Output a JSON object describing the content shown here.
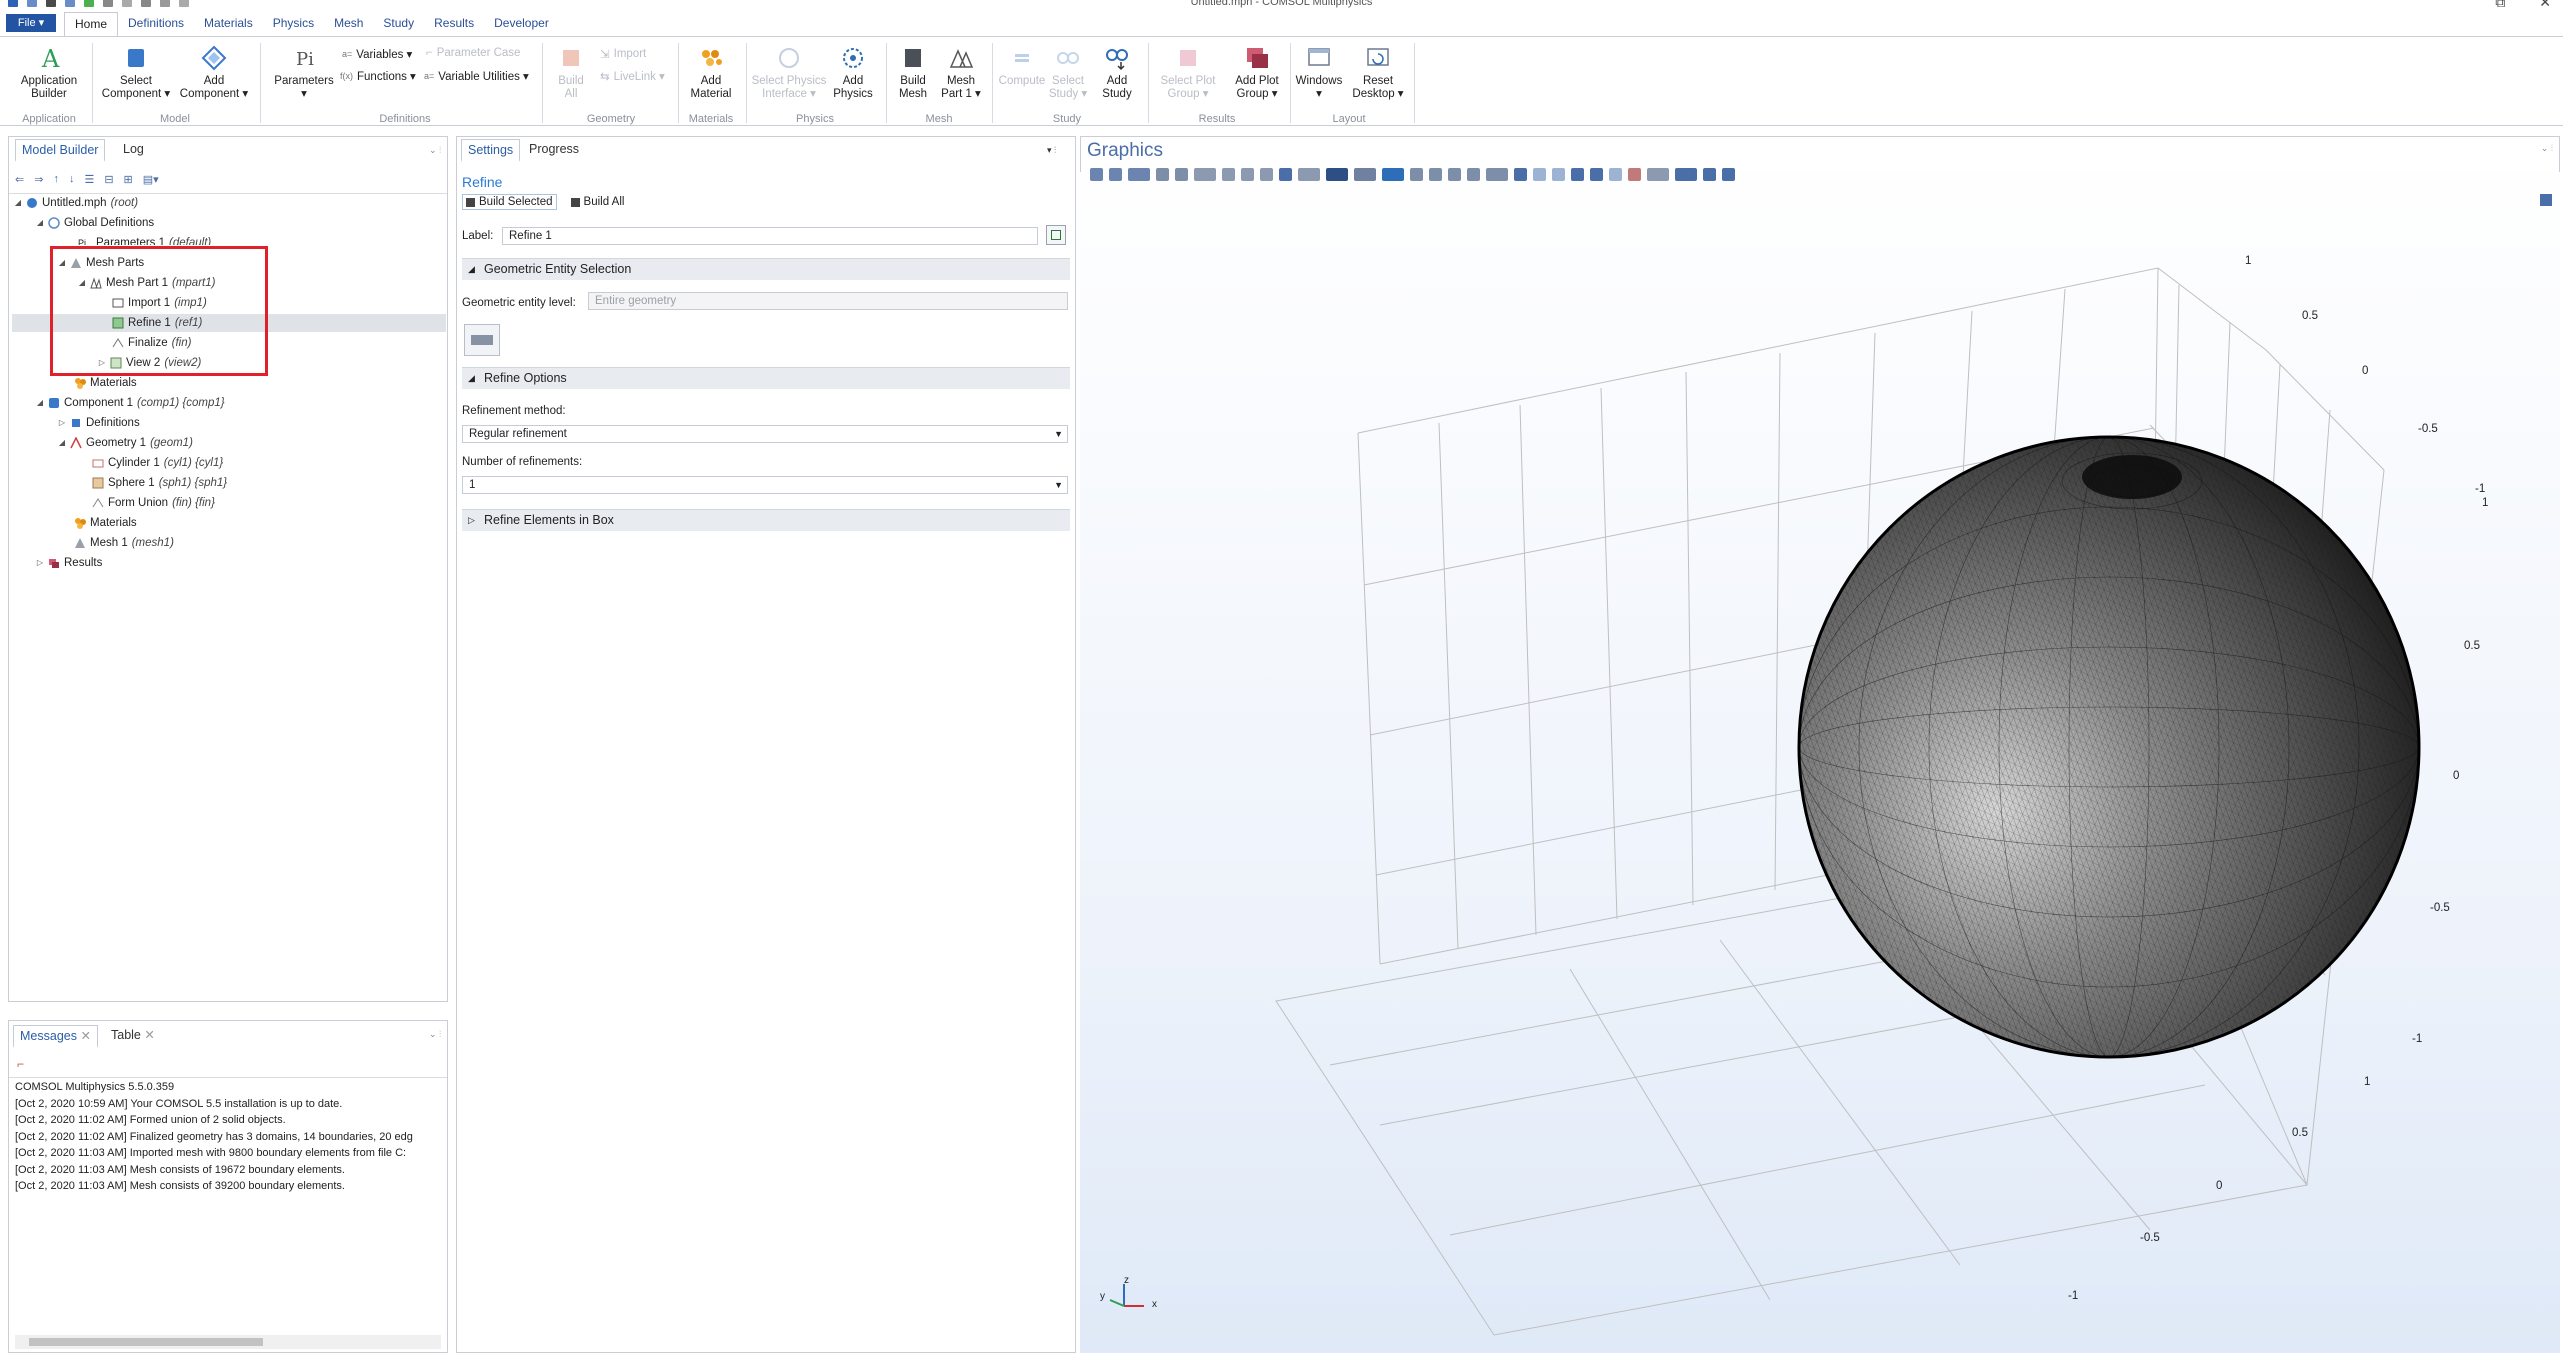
{
  "window": {
    "title": "Untitled.mph - COMSOL Multiphysics"
  },
  "menu": {
    "file": "File ▾",
    "tabs": [
      "Home",
      "Definitions",
      "Materials",
      "Physics",
      "Mesh",
      "Study",
      "Results",
      "Developer"
    ],
    "active": "Home"
  },
  "ribbon": {
    "app_builder": {
      "line1": "Application",
      "line2": "Builder"
    },
    "select_component": {
      "line1": "Select",
      "line2": "Component ▾"
    },
    "add_component": {
      "line1": "Add",
      "line2": "Component ▾"
    },
    "parameters": {
      "line1": "Parameters",
      "line2": "▾"
    },
    "variables": "Variables ▾",
    "functions": "Functions ▾",
    "parameter_case": "Parameter Case",
    "variable_utilities": "Variable Utilities ▾",
    "build_all": {
      "line1": "Build",
      "line2": "All"
    },
    "import": "Import",
    "livelink": "LiveLink ▾",
    "add_material": {
      "line1": "Add",
      "line2": "Material"
    },
    "select_physics": {
      "line1": "Select Physics",
      "line2": "Interface ▾"
    },
    "add_physics": {
      "line1": "Add",
      "line2": "Physics"
    },
    "build_mesh": {
      "line1": "Build",
      "line2": "Mesh"
    },
    "mesh_part": {
      "line1": "Mesh",
      "line2": "Part 1 ▾"
    },
    "compute": {
      "line1": "Compute",
      "line2": ""
    },
    "select_study": {
      "line1": "Select",
      "line2": "Study ▾"
    },
    "add_study": {
      "line1": "Add",
      "line2": "Study"
    },
    "select_plot_group": {
      "line1": "Select Plot",
      "line2": "Group ▾"
    },
    "add_plot_group": {
      "line1": "Add Plot",
      "line2": "Group ▾"
    },
    "windows": {
      "line1": "Windows",
      "line2": "▾"
    },
    "reset_desktop": {
      "line1": "Reset",
      "line2": "Desktop ▾"
    },
    "groups": [
      "Application",
      "Model",
      "Definitions",
      "Geometry",
      "Materials",
      "Physics",
      "Mesh",
      "Study",
      "Results",
      "Layout"
    ]
  },
  "model_builder": {
    "tabs": [
      "Model Builder",
      "Log"
    ],
    "tree": [
      {
        "label": "Untitled.mph",
        "tag": "(root)"
      },
      {
        "label": "Global Definitions",
        "tag": ""
      },
      {
        "label": "Parameters 1",
        "tag": "(default)"
      },
      {
        "label": "Mesh Parts",
        "tag": ""
      },
      {
        "label": "Mesh Part 1",
        "tag": "(mpart1)"
      },
      {
        "label": "Import 1",
        "tag": "(imp1)"
      },
      {
        "label": "Refine 1",
        "tag": "(ref1)"
      },
      {
        "label": "Finalize",
        "tag": "(fin)"
      },
      {
        "label": "View 2",
        "tag": "(view2)"
      },
      {
        "label": "Materials",
        "tag": ""
      },
      {
        "label": "Component 1",
        "tag": "(comp1) {comp1}"
      },
      {
        "label": "Definitions",
        "tag": ""
      },
      {
        "label": "Geometry 1",
        "tag": "(geom1)"
      },
      {
        "label": "Cylinder 1",
        "tag": "(cyl1) {cyl1}"
      },
      {
        "label": "Sphere 1",
        "tag": "(sph1) {sph1}"
      },
      {
        "label": "Form Union",
        "tag": "(fin) {fin}"
      },
      {
        "label": "Materials",
        "tag": ""
      },
      {
        "label": "Mesh 1",
        "tag": "(mesh1)"
      },
      {
        "label": "Results",
        "tag": ""
      }
    ]
  },
  "messages": {
    "tabs": [
      "Messages",
      "Table"
    ],
    "lines": [
      "COMSOL Multiphysics 5.5.0.359",
      "[Oct 2, 2020 10:59 AM] Your COMSOL 5.5 installation is up to date.",
      "[Oct 2, 2020 11:02 AM] Formed union of 2 solid objects.",
      "[Oct 2, 2020 11:02 AM] Finalized geometry has 3 domains, 14 boundaries, 20 edg",
      "[Oct 2, 2020 11:03 AM] Imported mesh with 9800 boundary elements from file C:",
      "[Oct 2, 2020 11:03 AM] Mesh consists of 19672 boundary elements.",
      "[Oct 2, 2020 11:03 AM] Mesh consists of 39200 boundary elements."
    ]
  },
  "settings": {
    "tabs": [
      "Settings",
      "Progress"
    ],
    "heading": "Refine",
    "build_selected": "Build Selected",
    "build_all": "Build All",
    "label_caption": "Label:",
    "label_value": "Refine 1",
    "section_geo": "Geometric Entity Selection",
    "geo_level_caption": "Geometric entity level:",
    "geo_level_value": "Entire geometry",
    "section_refine": "Refine Options",
    "method_caption": "Refinement method:",
    "method_value": "Regular refinement",
    "count_caption": "Number of refinements:",
    "count_value": "1",
    "section_box": "Refine Elements in Box"
  },
  "graphics": {
    "title": "Graphics",
    "axis_labels": {
      "z": [
        "1",
        "0.5",
        "0",
        "-0.5",
        "-1"
      ],
      "right": [
        "1",
        "0.5",
        "0",
        "-0.5",
        "-1"
      ],
      "front": [
        "1",
        "0.5",
        "0",
        "-0.5",
        "-1"
      ],
      "top": [
        "1",
        "0.5",
        "0",
        "-0.5",
        "-1"
      ]
    },
    "triad": {
      "x": "x",
      "y": "y",
      "z": "z"
    }
  }
}
